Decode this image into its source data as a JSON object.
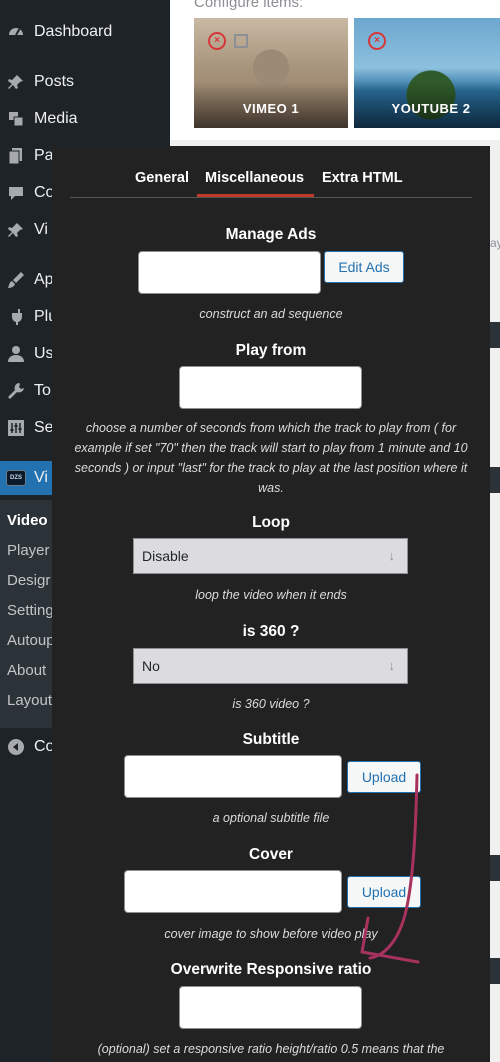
{
  "sidebar": {
    "items": [
      {
        "label": "Dashboard",
        "icon": "dashboard-icon"
      },
      {
        "label": "Posts",
        "icon": "pin-icon"
      },
      {
        "label": "Media",
        "icon": "media-icon"
      },
      {
        "label": "Pa",
        "icon": "pages-icon"
      },
      {
        "label": "Co",
        "icon": "comments-icon"
      },
      {
        "label": "Vi",
        "icon": "pin-icon"
      },
      {
        "label": "Ap",
        "icon": "appearance-icon"
      },
      {
        "label": "Plu",
        "icon": "plugins-icon"
      },
      {
        "label": "Us",
        "icon": "users-icon"
      },
      {
        "label": "To",
        "icon": "tools-icon"
      },
      {
        "label": "Se",
        "icon": "settings-icon"
      },
      {
        "label": "Vi",
        "icon": "videoplayer-logo-icon"
      }
    ],
    "submenu": [
      "Video",
      "Player",
      "Desigr",
      "Setting",
      "Autoup",
      "About",
      "Layout"
    ],
    "collapse_label": "Co"
  },
  "main": {
    "configure_label": "Configure items:",
    "thumbnails": [
      {
        "title": "VIMEO 1"
      },
      {
        "title": "YOUTUBE 2"
      }
    ],
    "side_text": "ay"
  },
  "modal": {
    "tabs": [
      "General",
      "Miscellaneous",
      "Extra HTML"
    ],
    "active_tab": "Miscellaneous",
    "manage_ads": {
      "title": "Manage Ads",
      "value": "",
      "button": "Edit Ads",
      "hint": "construct an ad sequence"
    },
    "play_from": {
      "title": "Play from",
      "value": "",
      "hint": "choose a number of seconds from which the track to play from ( for example if set \"70\" then the track will start to play from 1 minute and 10 seconds ) or input \"last\" for the track to play at the last position where it was."
    },
    "loop": {
      "title": "Loop",
      "selected": "Disable",
      "hint": "loop the video when it ends"
    },
    "is360": {
      "title": "is 360 ?",
      "selected": "No",
      "hint": "is 360 video ?"
    },
    "subtitle": {
      "title": "Subtitle",
      "value": "",
      "button": "Upload",
      "hint": "a optional subtitle file"
    },
    "cover": {
      "title": "Cover",
      "value": "",
      "button": "Upload",
      "hint": "cover image to show before video play"
    },
    "responsive_ratio": {
      "title": "Overwrite Responsive ratio",
      "value": "",
      "hint": "(optional) set a responsive ratio height/ratio 0.5 means that the"
    }
  },
  "colors": {
    "sidebar_bg": "#1d2327",
    "modal_bg": "#222222",
    "accent_blue": "#2271b1",
    "tab_underline": "#c0392b",
    "annotation_arrow": "#a8325e"
  }
}
